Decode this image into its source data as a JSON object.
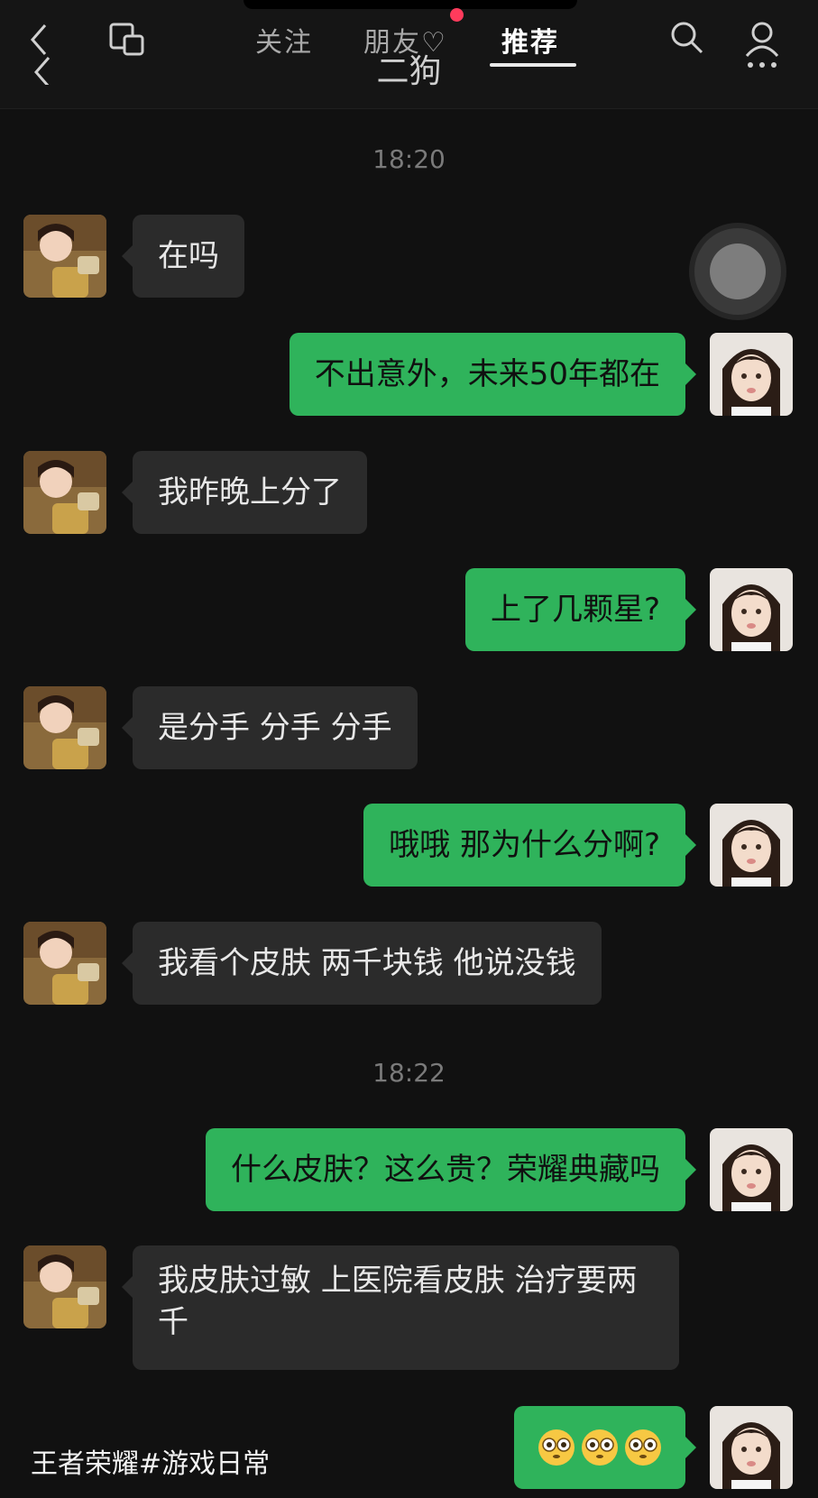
{
  "header": {
    "tabs": [
      "关注",
      "朋友",
      "推荐"
    ],
    "active_tab": "推荐",
    "friends_heart": "♡",
    "chat_title": "二狗",
    "icons": [
      "back-chevron-icon",
      "copy-icon",
      "search-icon",
      "profile-menu-icon"
    ],
    "colors": {
      "notification_dot": "#ff3b5c"
    }
  },
  "chat": {
    "timestamps": [
      "18:20",
      "18:22"
    ],
    "messages": [
      {
        "side": "in",
        "text": "在吗"
      },
      {
        "side": "out",
        "text": "不出意外，未来50年都在"
      },
      {
        "side": "in",
        "text": "我昨晚上分了"
      },
      {
        "side": "out",
        "text": "上了几颗星?"
      },
      {
        "side": "in",
        "text": "是分手 分手 分手"
      },
      {
        "side": "out",
        "text": "哦哦 那为什么分啊?"
      },
      {
        "side": "in",
        "text": "我看个皮肤 两千块钱 他说没钱"
      },
      {
        "side": "out",
        "text": "什么皮肤？这么贵？荣耀典藏吗"
      },
      {
        "side": "in",
        "text": "我皮肤过敏 上医院看皮肤 治疗要两千"
      },
      {
        "side": "out",
        "text": "",
        "emoji": [
          "flushed-face",
          "flushed-face",
          "flushed-face"
        ]
      }
    ],
    "colors": {
      "incoming_bubble": "#2b2b2b",
      "outgoing_bubble": "#2fb35b",
      "background": "#111111"
    }
  },
  "caption": "王者荣耀#游戏日常"
}
